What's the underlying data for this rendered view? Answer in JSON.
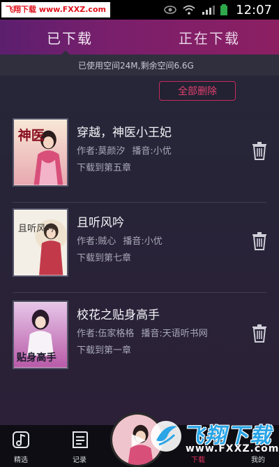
{
  "status_bar": {
    "watermark": "飞翔下载 www.FXXZ.com",
    "time": "12:07"
  },
  "tabs": [
    {
      "label": "已下载",
      "active": true
    },
    {
      "label": "正在下载",
      "active": false
    }
  ],
  "storage": {
    "text": "已使用空间24M,剩余空间6.6G"
  },
  "delete_all_label": "全部删除",
  "books": [
    {
      "title": "穿越，神医小王妃",
      "author": "作者:莫颜汐",
      "narrator": "播音:小优",
      "progress": "下载到第五章",
      "cover_text": "神医"
    },
    {
      "title": "且听风吟",
      "author": "作者:贼心",
      "narrator": "播音:小优",
      "progress": "下载到第七章",
      "cover_text": "且听风吟"
    },
    {
      "title": "校花之贴身高手",
      "author": "作者:伍家格格",
      "narrator": "播音:天语听书网",
      "progress": "下载到第一章",
      "cover_text": "贴身高手"
    }
  ],
  "bottom_nav": [
    {
      "label": "精选",
      "icon": "music-note-icon"
    },
    {
      "label": "记录",
      "icon": "document-icon"
    },
    {
      "label": "下载",
      "icon": "download-icon",
      "active": true
    },
    {
      "label": "我的",
      "icon": "profile-icon"
    }
  ],
  "watermark_logo": {
    "text": "飞翔下载",
    "url": "www.FXXZ.com"
  },
  "colors": {
    "accent": "#e0305e",
    "header_start": "#5b1f6e",
    "header_end": "#8c1f62",
    "background": "#262638"
  }
}
